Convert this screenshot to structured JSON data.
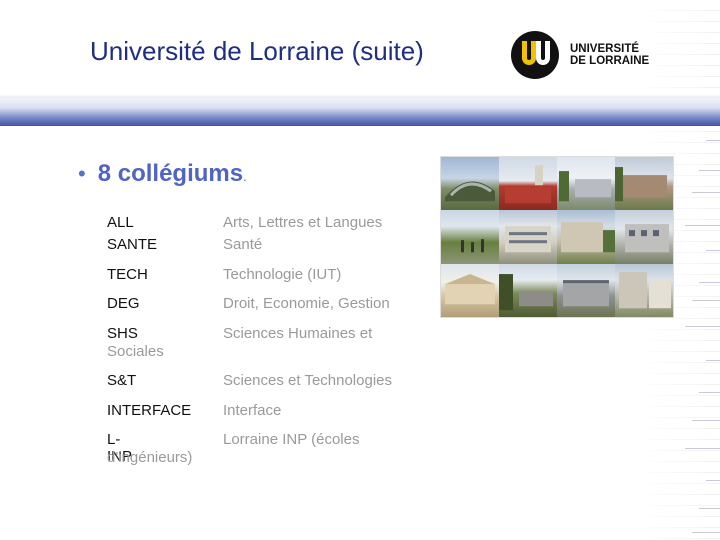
{
  "header": {
    "title": "Université de Lorraine (suite)",
    "logo_line1": "UNIVERSITÉ",
    "logo_line2": "DE LORRAINE"
  },
  "bullet": {
    "text": "8 collégiums",
    "tail": "."
  },
  "collegiums": [
    {
      "code": "ALL",
      "label": "Arts, Lettres et Langues"
    },
    {
      "code": "SANTE",
      "label": "Santé"
    },
    {
      "code": "TECH",
      "label": "Technologie (IUT)"
    },
    {
      "code": "DEG",
      "label": "Droit, Economie, Gestion"
    },
    {
      "code": "SHS",
      "label": "Sciences Humaines et",
      "continuation": "Sociales"
    },
    {
      "code": "S&T",
      "label": "Sciences et Technologies"
    },
    {
      "code": "INTERFACE",
      "label": "Interface"
    },
    {
      "code": "L-INP",
      "label": "Lorraine INP (écoles",
      "continuation": "d'ingénieurs)"
    }
  ],
  "colors": {
    "title": "#1f2d82",
    "bullet": "#5064c4",
    "band_dark": "#3e52a8"
  }
}
